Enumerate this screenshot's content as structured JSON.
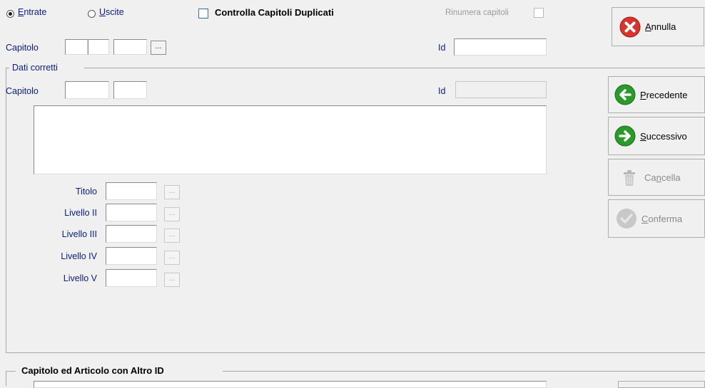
{
  "top": {
    "radio_entrate": {
      "u": "E",
      "rest": "ntrate"
    },
    "radio_uscite": {
      "u": "U",
      "rest": "scite"
    },
    "checkbox_duplicati": "Controlla Capitoli Duplicati",
    "rinumera": "Rinumera capitoli",
    "capitolo_label": "Capitolo",
    "id_label": "Id",
    "ellipsis": "..."
  },
  "dati_corretti": {
    "group_title": "Dati corretti",
    "capitolo_label": "Capitolo",
    "id_label": "Id",
    "livelli": [
      {
        "label": "Titolo"
      },
      {
        "label": "Livello II"
      },
      {
        "label": "Livello III"
      },
      {
        "label": "Livello IV"
      },
      {
        "label": "Livello V"
      }
    ],
    "ellipsis": "..."
  },
  "bottom_group": {
    "title": "Capitolo ed Articolo con Altro ID"
  },
  "buttons": {
    "annulla": {
      "u": "A",
      "rest": "nnulla"
    },
    "precedente": {
      "u": "P",
      "rest": "recedente"
    },
    "successivo": {
      "u": "S",
      "rest": "uccessivo"
    },
    "cancella": {
      "pre": "Ca",
      "u": "n",
      "rest": "cella"
    },
    "conferma": {
      "u": "C",
      "rest": "onferma"
    }
  },
  "colors": {
    "label_blue": "#0b1a8a",
    "annulla_red": "#d9342b",
    "nav_green": "#2a9a2a",
    "disabled_gray": "#b8b8b8"
  }
}
